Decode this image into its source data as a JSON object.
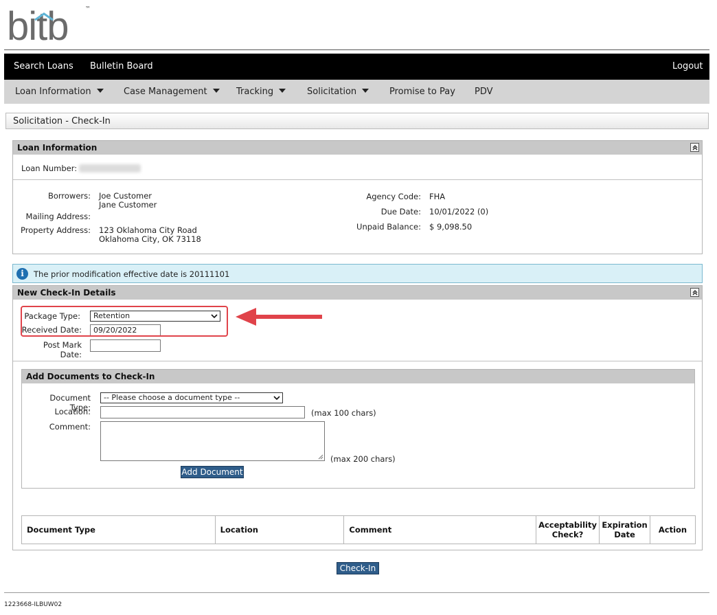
{
  "app": {
    "logo_text": "bitb",
    "trademark": "™"
  },
  "topnav": {
    "search_loans": "Search Loans",
    "bulletin_board": "Bulletin Board",
    "logout": "Logout"
  },
  "subnav": {
    "loan_information": "Loan Information",
    "case_management": "Case Management",
    "tracking": "Tracking",
    "solicitation": "Solicitation",
    "promise_to_pay": "Promise to Pay",
    "pdv": "PDV"
  },
  "page": {
    "title": "Solicitation - Check-In"
  },
  "loan_info": {
    "header": "Loan Information",
    "loan_number_label": "Loan Number:",
    "borrowers_label": "Borrowers:",
    "borrower_1": "Joe Customer",
    "borrower_2": "Jane Customer",
    "mailing_address_label": "Mailing Address:",
    "property_address_label": "Property Address:",
    "property_address_line1": "123 Oklahoma City Road",
    "property_address_line2": "Oklahoma City, OK 73118",
    "agency_code_label": "Agency Code:",
    "agency_code": "FHA",
    "due_date_label": "Due Date:",
    "due_date": "10/01/2022 (0)",
    "unpaid_balance_label": "Unpaid Balance:",
    "unpaid_balance": "$ 9,098.50"
  },
  "notice": {
    "text": "The prior modification effective date is 20111101"
  },
  "checkin": {
    "header": "New Check-In Details",
    "package_type_label": "Package Type:",
    "package_type_value": "Retention",
    "received_date_label": "Received Date:",
    "received_date_value": "09/20/2022",
    "post_mark_date_label": "Post Mark Date:",
    "post_mark_date_value": ""
  },
  "add_docs": {
    "header": "Add Documents to Check-In",
    "document_type_label": "Document Type:",
    "document_type_value": "-- Please choose a document type --",
    "location_label": "Location:",
    "location_hint": "(max 100 chars)",
    "comment_label": "Comment:",
    "comment_hint": "(max 200 chars)",
    "add_button": "Add Document"
  },
  "doc_table": {
    "columns": [
      "Document Type",
      "Location",
      "Comment",
      "Acceptability Check?",
      "Expiration Date",
      "Action"
    ]
  },
  "actions": {
    "check_in": "Check-In"
  },
  "footer": {
    "text": "1223668-ILBUW02"
  },
  "colors": {
    "nav_bg": "#000000",
    "subnav_bg": "#d4d4d4",
    "button_bg": "#2f5d8a",
    "highlight_red": "#e0434a",
    "info_bg": "#d9f0f7"
  }
}
